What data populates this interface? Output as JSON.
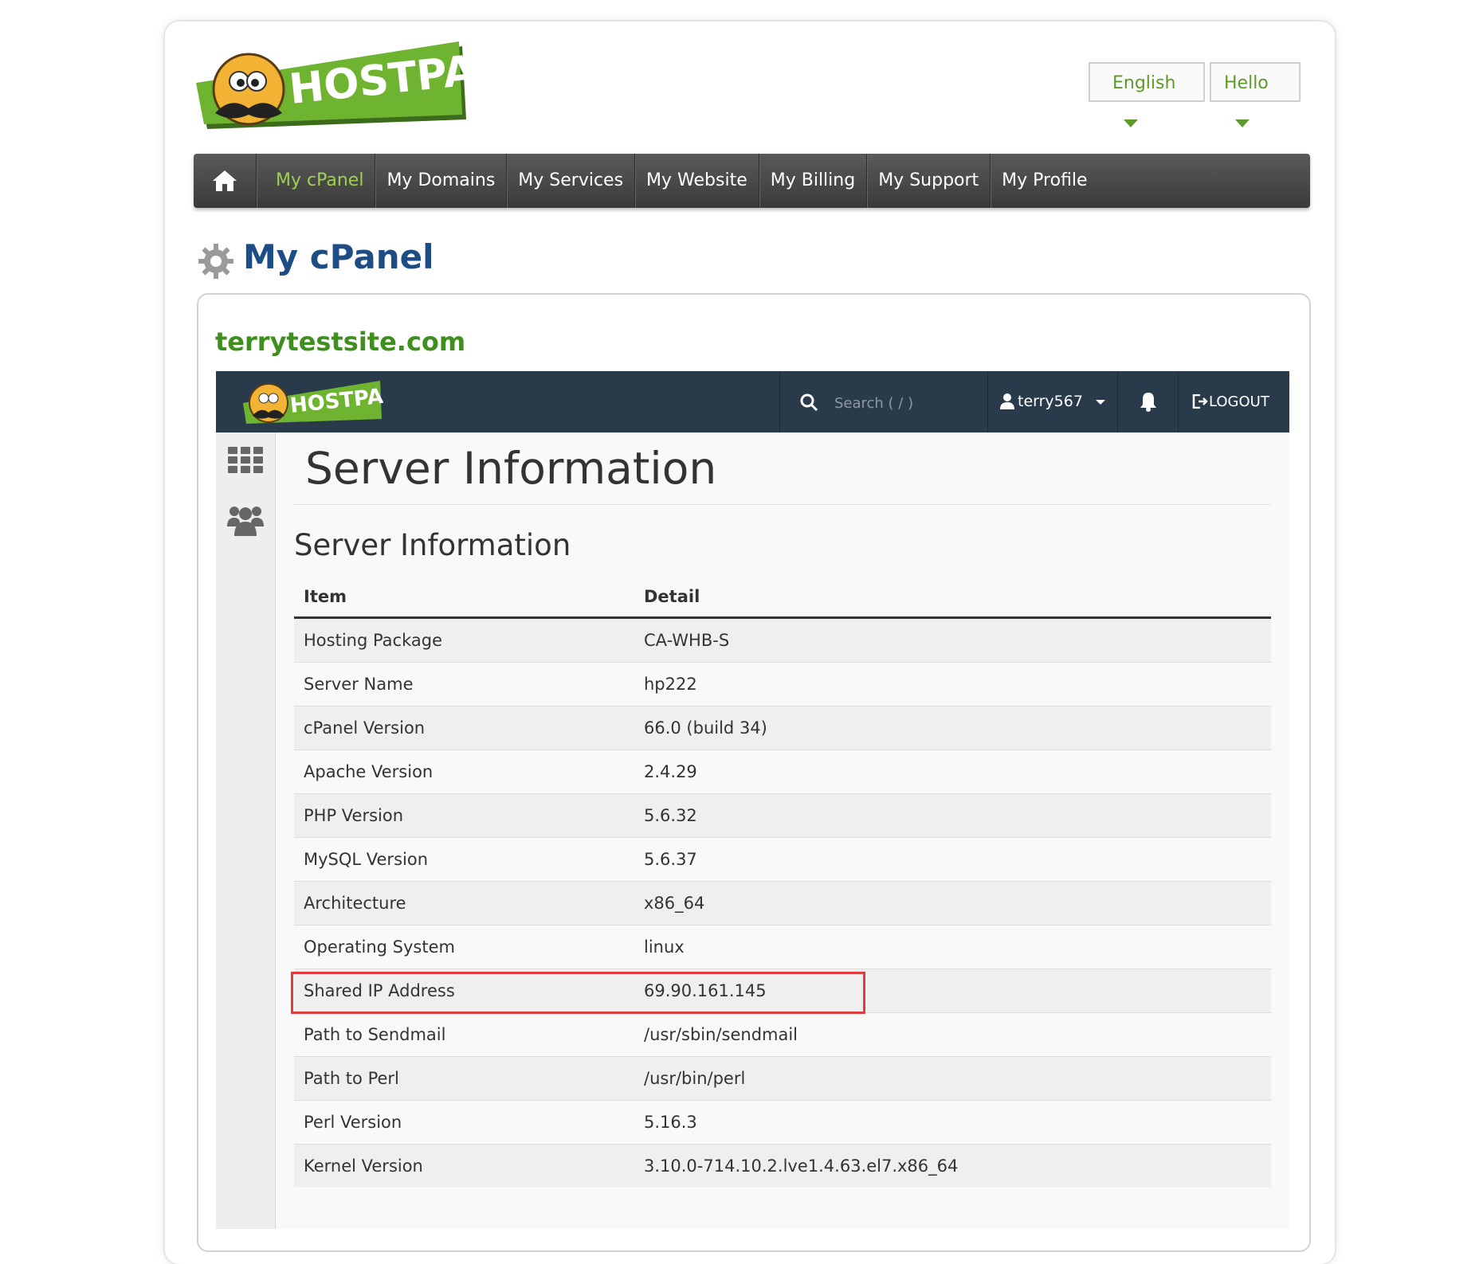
{
  "brand": {
    "logo_text": "HOSTPAPA",
    "accent_green": "#5e9a2a",
    "nav_active": "#9fd14f",
    "title_blue": "#1e4d86"
  },
  "top_buttons": {
    "language": "English",
    "greeting": "Hello"
  },
  "nav": {
    "items": [
      "My cPanel",
      "My Domains",
      "My Services",
      "My Website",
      "My Billing",
      "My Support",
      "My Profile"
    ]
  },
  "page_title": "My cPanel",
  "site_name": "terrytestsite.com",
  "cpanel": {
    "logo_text": "HOSTPAPA",
    "search_placeholder": "Search ( / )",
    "username": "terry567",
    "logout": "LOGOUT",
    "icons": [
      "search-icon",
      "user-icon",
      "bell-icon",
      "logout-icon",
      "grid-icon",
      "users-icon"
    ]
  },
  "content": {
    "heading": "Server Information",
    "subheading": "Server Information",
    "columns": [
      "Item",
      "Detail"
    ],
    "rows": [
      [
        "Hosting Package",
        "CA-WHB-S"
      ],
      [
        "Server Name",
        "hp222"
      ],
      [
        "cPanel Version",
        "66.0 (build 34)"
      ],
      [
        "Apache Version",
        "2.4.29"
      ],
      [
        "PHP Version",
        "5.6.32"
      ],
      [
        "MySQL Version",
        "5.6.37"
      ],
      [
        "Architecture",
        "x86_64"
      ],
      [
        "Operating System",
        "linux"
      ],
      [
        "Shared IP Address",
        "69.90.161.145"
      ],
      [
        "Path to Sendmail",
        "/usr/sbin/sendmail"
      ],
      [
        "Path to Perl",
        "/usr/bin/perl"
      ],
      [
        "Perl Version",
        "5.16.3"
      ],
      [
        "Kernel Version",
        "3.10.0-714.10.2.lve1.4.63.el7.x86_64"
      ]
    ],
    "highlight_color": "#e23b3b"
  }
}
